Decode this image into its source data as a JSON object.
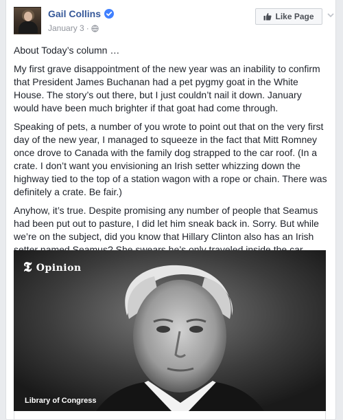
{
  "post": {
    "author": "Gail Collins",
    "date": "January 3",
    "like_page_label": "Like Page",
    "paragraphs": [
      "About Today’s column …",
      "My first grave disappointment of the new year was an inability to confirm that President James Buchanan had a pet pygmy goat in the White House. The story’s out there, but I just couldn’t nail it down. January would have been much brighter if that goat had come through.",
      "Speaking of pets, a number of you wrote to point out that on the very first day of the new year, I managed to squeeze in the fact that Mitt Romney once drove to Canada with the family dog strapped to the car roof. (In a crate. I don’t want you envisioning an Irish setter whizzing down the highway tied to the top of a station wagon with a rope or chain. There was definitely a crate. Be fair.)",
      "Anyhow, it’s true. Despite promising any number of people that Seamus had been put out to pasture, I did let him sneak back in. Sorry. But while we’re on the subject, did you know that Hillary Clinton also has an Irish setter named Seamus? She swears he’s only traveled inside the car."
    ],
    "photo": {
      "brand_glyph": "𝕿",
      "brand_label": "Opinion",
      "credit": "Library of Congress"
    }
  },
  "colors": {
    "link_blue": "#365899",
    "verified_blue": "#4080ff",
    "meta_gray": "#90949c"
  },
  "icons": [
    "verified-badge-icon",
    "globe-icon",
    "thumbs-up-icon",
    "chevron-down-icon"
  ]
}
